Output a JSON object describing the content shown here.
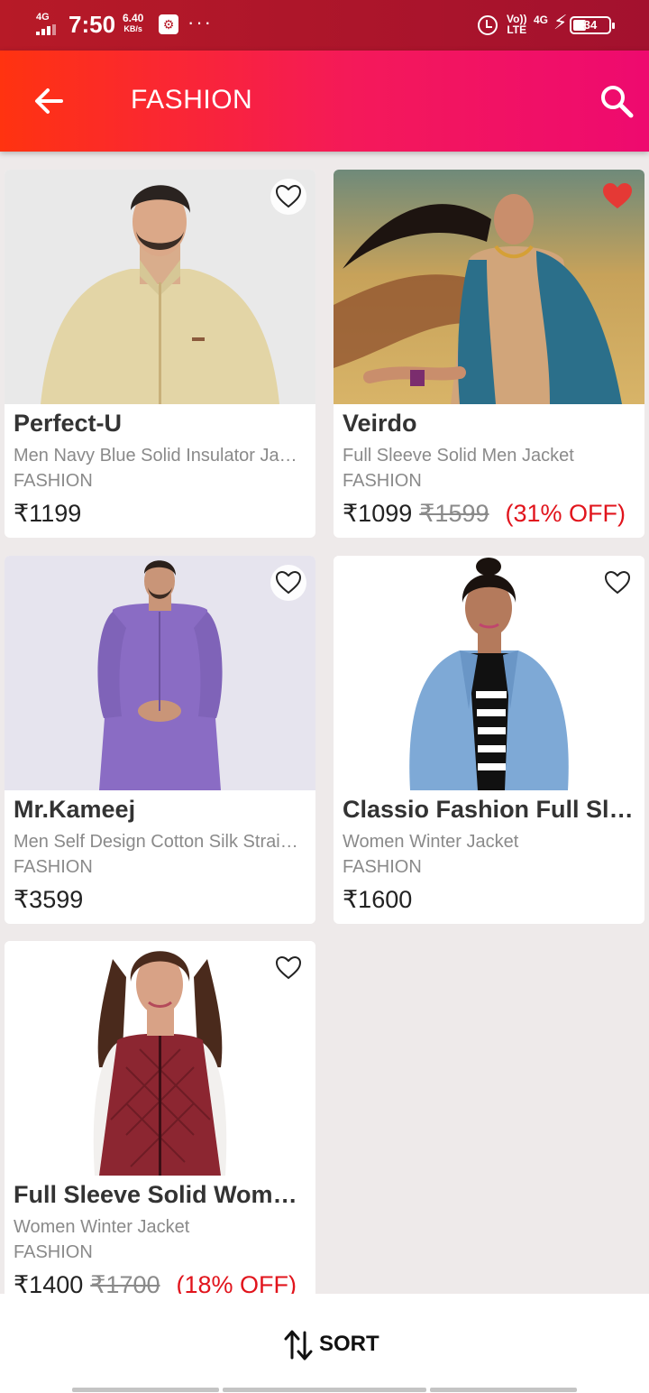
{
  "status_bar": {
    "network": "4G",
    "time": "7:50",
    "speed_value": "6.40",
    "speed_unit": "KB/s",
    "volte_top": "Vo))",
    "volte_bottom": "LTE",
    "network2": "4G",
    "battery": "34",
    "battery_level": 0.34
  },
  "app_bar": {
    "title": "FASHION",
    "back_icon": "arrow-left-icon",
    "search_icon": "search-icon"
  },
  "products": [
    {
      "brand": "Perfect-U",
      "description": "Men Navy Blue Solid Insulator Jacket",
      "category": "FASHION",
      "price": "₹1199",
      "mrp": "",
      "discount": "",
      "wishlisted": false,
      "image": "man-beige-zip-jacket"
    },
    {
      "brand": "Veirdo",
      "description": "Full Sleeve Solid Men Jacket",
      "category": "FASHION",
      "price": "₹1099",
      "mrp": "₹1599",
      "discount": "(31% OFF)",
      "wishlisted": true,
      "image": "woman-blue-saree-field"
    },
    {
      "brand": "Mr.Kameej",
      "description": "Men Self Design Cotton Silk Straight Kurta",
      "category": "FASHION",
      "price": "₹3599",
      "mrp": "",
      "discount": "",
      "wishlisted": false,
      "image": "man-purple-kurta"
    },
    {
      "brand": "Classio Fashion  Full Sleeve",
      "description": "Women Winter Jacket",
      "category": "FASHION",
      "price": "₹1600",
      "mrp": "",
      "discount": "",
      "wishlisted": false,
      "image": "woman-denim-jacket"
    },
    {
      "brand": "Full Sleeve Solid Women Jacket",
      "description": "Women Winter Jacket",
      "category": "FASHION",
      "price": "₹1400",
      "mrp": "₹1700",
      "discount": "(18% OFF)",
      "wishlisted": false,
      "image": "woman-maroon-quilted-vest"
    }
  ],
  "bottom_bar": {
    "sort_label": "SORT",
    "sort_icon": "sort-arrows-icon"
  },
  "colors": {
    "status_bar": "#b71a27",
    "app_bar_start": "#ff3310",
    "app_bar_end": "#ee0a6f",
    "discount": "#e1141c",
    "heart_active": "#e53935"
  }
}
